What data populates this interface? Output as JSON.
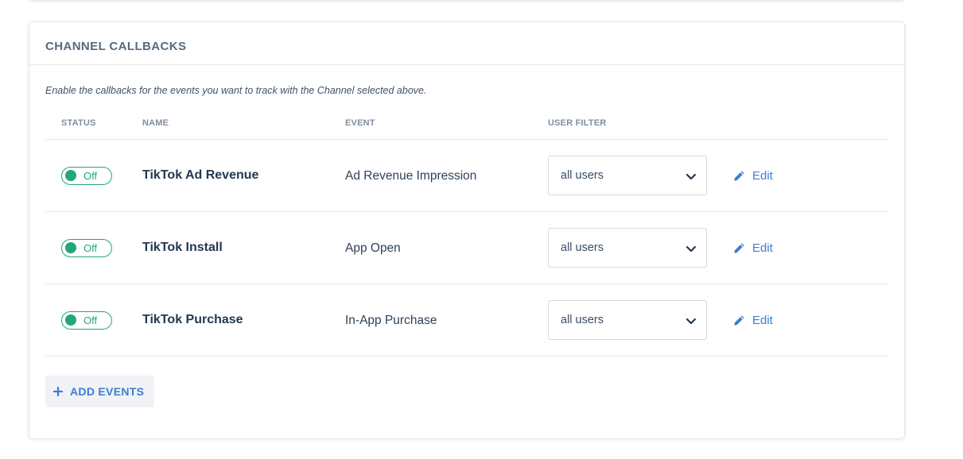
{
  "section": {
    "title": "CHANNEL CALLBACKS",
    "description": "Enable the callbacks for the events you want to track with the Channel selected above."
  },
  "table": {
    "headers": {
      "status": "STATUS",
      "name": "NAME",
      "event": "EVENT",
      "user_filter": "USER FILTER"
    },
    "rows": [
      {
        "status": "Off",
        "name": "TikTok Ad Revenue",
        "event": "Ad Revenue Impression",
        "user_filter": "all users",
        "edit_label": "Edit"
      },
      {
        "status": "Off",
        "name": "TikTok Install",
        "event": "App Open",
        "user_filter": "all users",
        "edit_label": "Edit"
      },
      {
        "status": "Off",
        "name": "TikTok Purchase",
        "event": "In-App Purchase",
        "user_filter": "all users",
        "edit_label": "Edit"
      }
    ]
  },
  "add_button": {
    "label": "ADD EVENTS",
    "icon": "plus-icon"
  },
  "icons": {
    "edit": "pencil-icon",
    "select": "chevron-down-icon"
  },
  "colors": {
    "toggle_accent": "#22a77b",
    "link": "#3f7ccf",
    "title": "#566a81"
  }
}
